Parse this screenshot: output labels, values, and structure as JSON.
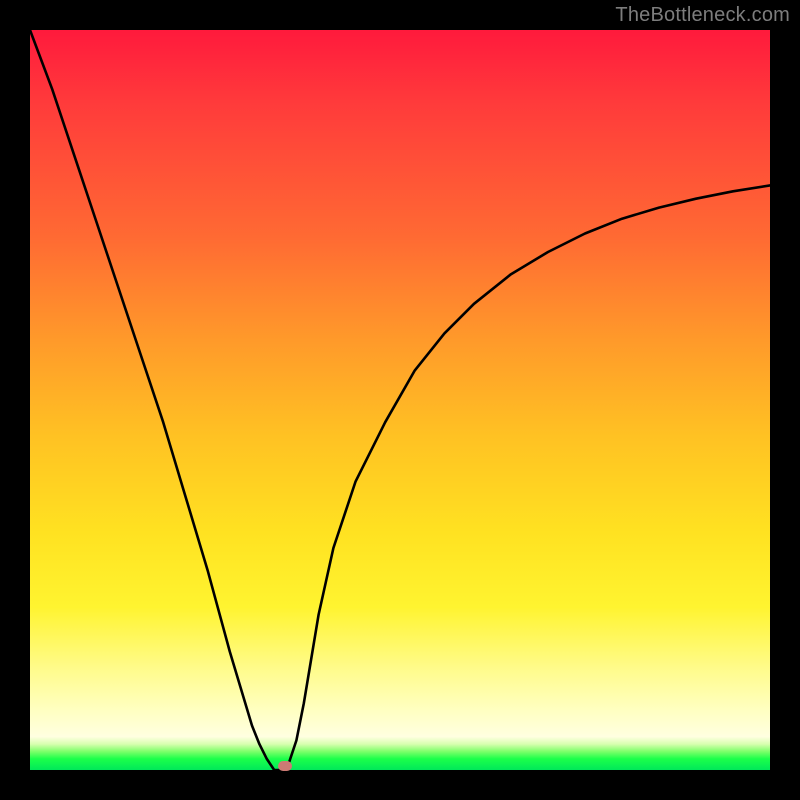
{
  "watermark": "TheBottleneck.com",
  "chart_data": {
    "type": "line",
    "title": "",
    "xlabel": "",
    "ylabel": "",
    "xlim": [
      0,
      1
    ],
    "ylim": [
      0,
      1
    ],
    "background_gradient": {
      "top": "#ff1a3c",
      "mid": "#ffe221",
      "bottom_band": "#00e85a"
    },
    "series": [
      {
        "name": "curve",
        "x": [
          0.0,
          0.03,
          0.06,
          0.09,
          0.12,
          0.15,
          0.18,
          0.21,
          0.24,
          0.27,
          0.3,
          0.31,
          0.32,
          0.33,
          0.34,
          0.35,
          0.36,
          0.37,
          0.38,
          0.39,
          0.41,
          0.44,
          0.48,
          0.52,
          0.56,
          0.6,
          0.65,
          0.7,
          0.75,
          0.8,
          0.85,
          0.9,
          0.95,
          1.0
        ],
        "y": [
          1.0,
          0.92,
          0.83,
          0.74,
          0.65,
          0.56,
          0.47,
          0.37,
          0.27,
          0.16,
          0.06,
          0.035,
          0.015,
          0.0,
          0.0,
          0.01,
          0.04,
          0.09,
          0.15,
          0.21,
          0.3,
          0.39,
          0.47,
          0.54,
          0.59,
          0.63,
          0.67,
          0.7,
          0.725,
          0.745,
          0.76,
          0.772,
          0.782,
          0.79
        ]
      }
    ],
    "marker": {
      "x": 0.345,
      "y": 0.0,
      "color": "#cc7a74"
    }
  }
}
